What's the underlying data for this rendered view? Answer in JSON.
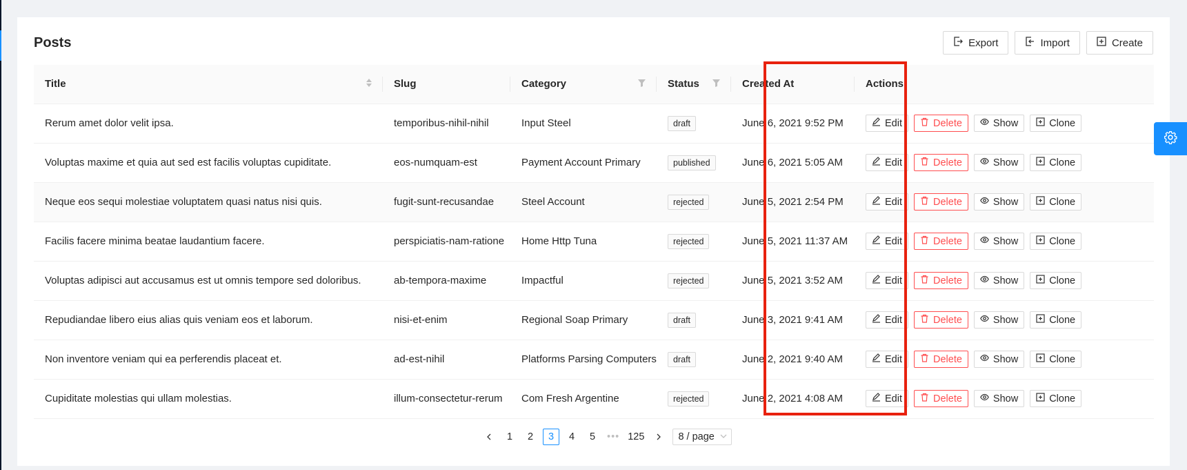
{
  "page": {
    "title": "Posts"
  },
  "header_actions": {
    "export": "Export",
    "import": "Import",
    "create": "Create"
  },
  "columns": {
    "title": "Title",
    "slug": "Slug",
    "category": "Category",
    "status": "Status",
    "created_at": "Created At",
    "actions": "Actions"
  },
  "row_actions": {
    "edit": "Edit",
    "delete": "Delete",
    "show": "Show",
    "clone": "Clone"
  },
  "rows": [
    {
      "title": "Rerum amet dolor velit ipsa.",
      "slug": "temporibus-nihil-nihil",
      "category": "Input Steel",
      "status": "draft",
      "created_at": "June 6, 2021 9:52 PM"
    },
    {
      "title": "Voluptas maxime et quia aut sed est facilis voluptas cupiditate.",
      "slug": "eos-numquam-est",
      "category": "Payment Account Primary",
      "status": "published",
      "created_at": "June 6, 2021 5:05 AM"
    },
    {
      "title": "Neque eos sequi molestiae voluptatem quasi natus nisi quis.",
      "slug": "fugit-sunt-recusandae",
      "category": "Steel Account",
      "status": "rejected",
      "created_at": "June 5, 2021 2:54 PM"
    },
    {
      "title": "Facilis facere minima beatae laudantium facere.",
      "slug": "perspiciatis-nam-ratione",
      "category": "Home Http Tuna",
      "status": "rejected",
      "created_at": "June 5, 2021 11:37 AM"
    },
    {
      "title": "Voluptas adipisci aut accusamus est ut omnis tempore sed doloribus.",
      "slug": "ab-tempora-maxime",
      "category": "Impactful",
      "status": "rejected",
      "created_at": "June 5, 2021 3:52 AM"
    },
    {
      "title": "Repudiandae libero eius alias quis veniam eos et laborum.",
      "slug": "nisi-et-enim",
      "category": "Regional Soap Primary",
      "status": "draft",
      "created_at": "June 3, 2021 9:41 AM"
    },
    {
      "title": "Non inventore veniam qui ea perferendis placeat et.",
      "slug": "ad-est-nihil",
      "category": "Platforms Parsing Computers",
      "status": "draft",
      "created_at": "June 2, 2021 9:40 AM"
    },
    {
      "title": "Cupiditate molestias qui ullam molestias.",
      "slug": "illum-consectetur-rerum",
      "category": "Com Fresh Argentine",
      "status": "rejected",
      "created_at": "June 2, 2021 4:08 AM"
    }
  ],
  "pagination": {
    "pages": [
      "1",
      "2",
      "3",
      "4",
      "5"
    ],
    "current": "3",
    "ellipsis": "•••",
    "last": "125",
    "page_size": "8 / page"
  },
  "colors": {
    "primary": "#1890ff",
    "danger": "#ff4d4f",
    "highlight": "#e8210e"
  },
  "icons": {
    "export": "export-icon",
    "import": "import-icon",
    "create": "plus-square-icon",
    "edit": "edit-icon",
    "delete": "delete-icon",
    "show": "eye-icon",
    "clone": "clone-icon",
    "settings": "gear-icon"
  }
}
